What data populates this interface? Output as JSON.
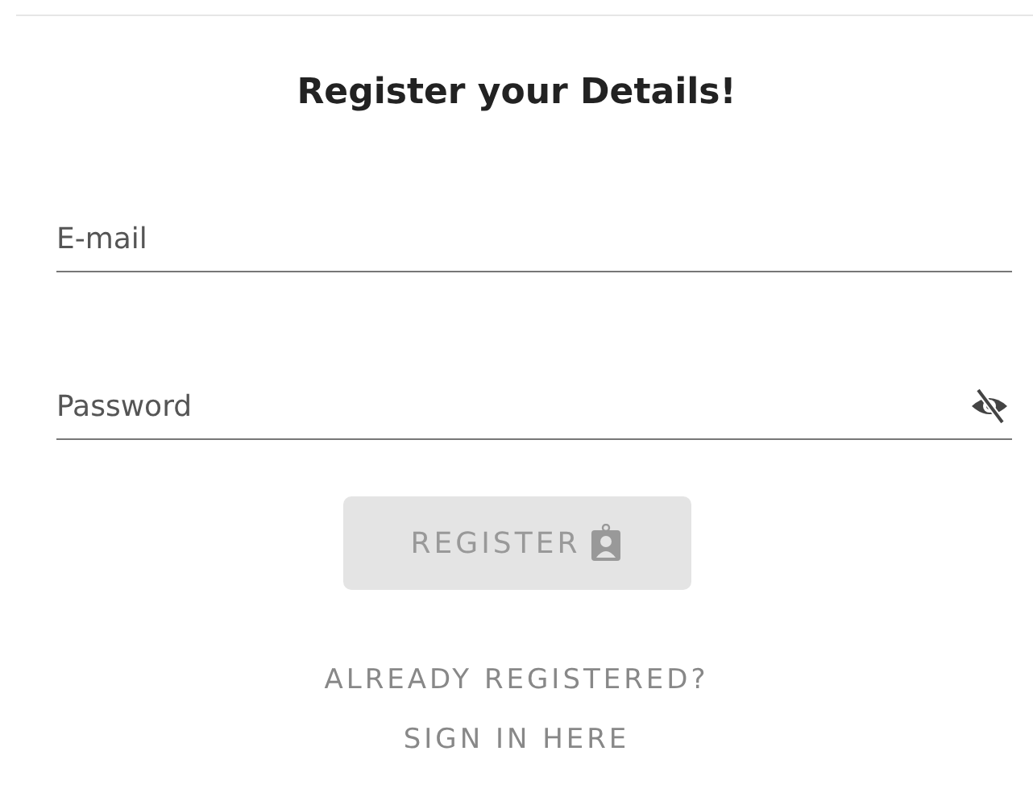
{
  "title": "Register your Details!",
  "fields": [
    {
      "kind": "email",
      "placeholder": "E-mail"
    },
    {
      "kind": "password",
      "placeholder": "Password",
      "revealed": false
    }
  ],
  "register_button": {
    "label": "REGISTER",
    "disabled": true
  },
  "sign_in_link": {
    "lines": [
      "ALREADY REGISTERED?",
      "SIGN IN HERE"
    ]
  }
}
